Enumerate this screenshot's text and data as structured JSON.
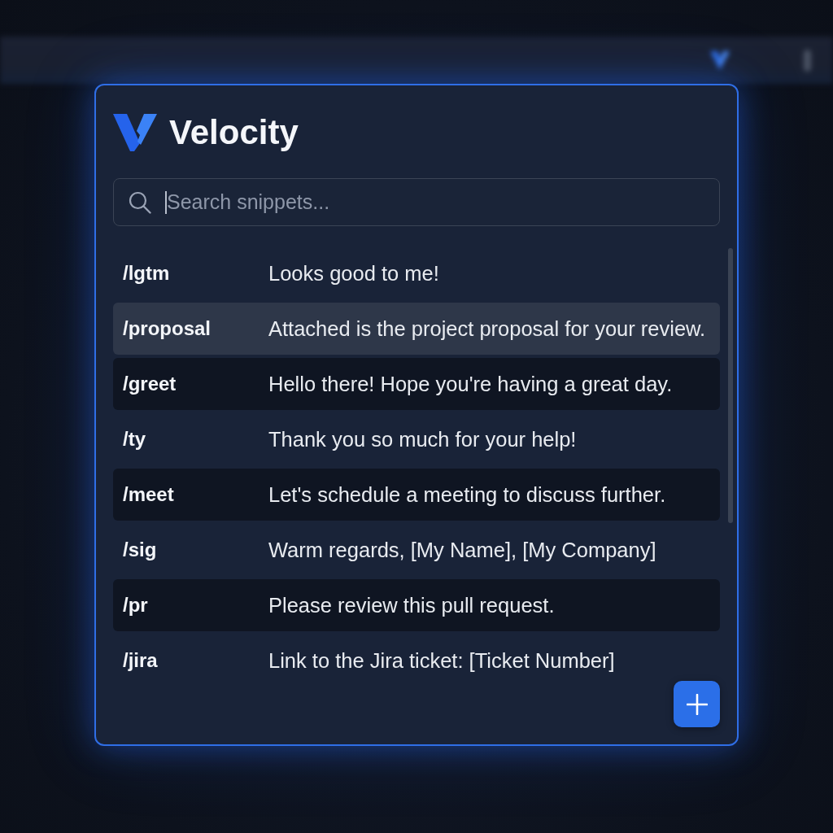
{
  "app": {
    "title": "Velocity"
  },
  "search": {
    "placeholder": "Search snippets...",
    "focused": true
  },
  "snippets": [
    {
      "command": "/lgtm",
      "text": "Looks good to me!",
      "selected": false,
      "shaded": false
    },
    {
      "command": "/proposal",
      "text": "Attached is the project proposal for your review.",
      "selected": true,
      "shaded": false
    },
    {
      "command": "/greet",
      "text": "Hello there! Hope you're having a great day.",
      "selected": false,
      "shaded": true
    },
    {
      "command": "/ty",
      "text": "Thank you so much for your help!",
      "selected": false,
      "shaded": false
    },
    {
      "command": "/meet",
      "text": "Let's schedule a meeting to discuss further.",
      "selected": false,
      "shaded": true
    },
    {
      "command": "/sig",
      "text": "Warm regards, [My Name], [My Company]",
      "selected": false,
      "shaded": false
    },
    {
      "command": "/pr",
      "text": "Please review this pull request.",
      "selected": false,
      "shaded": true
    },
    {
      "command": "/jira",
      "text": "Link to the Jira ticket: [Ticket Number]",
      "selected": false,
      "shaded": false
    }
  ]
}
